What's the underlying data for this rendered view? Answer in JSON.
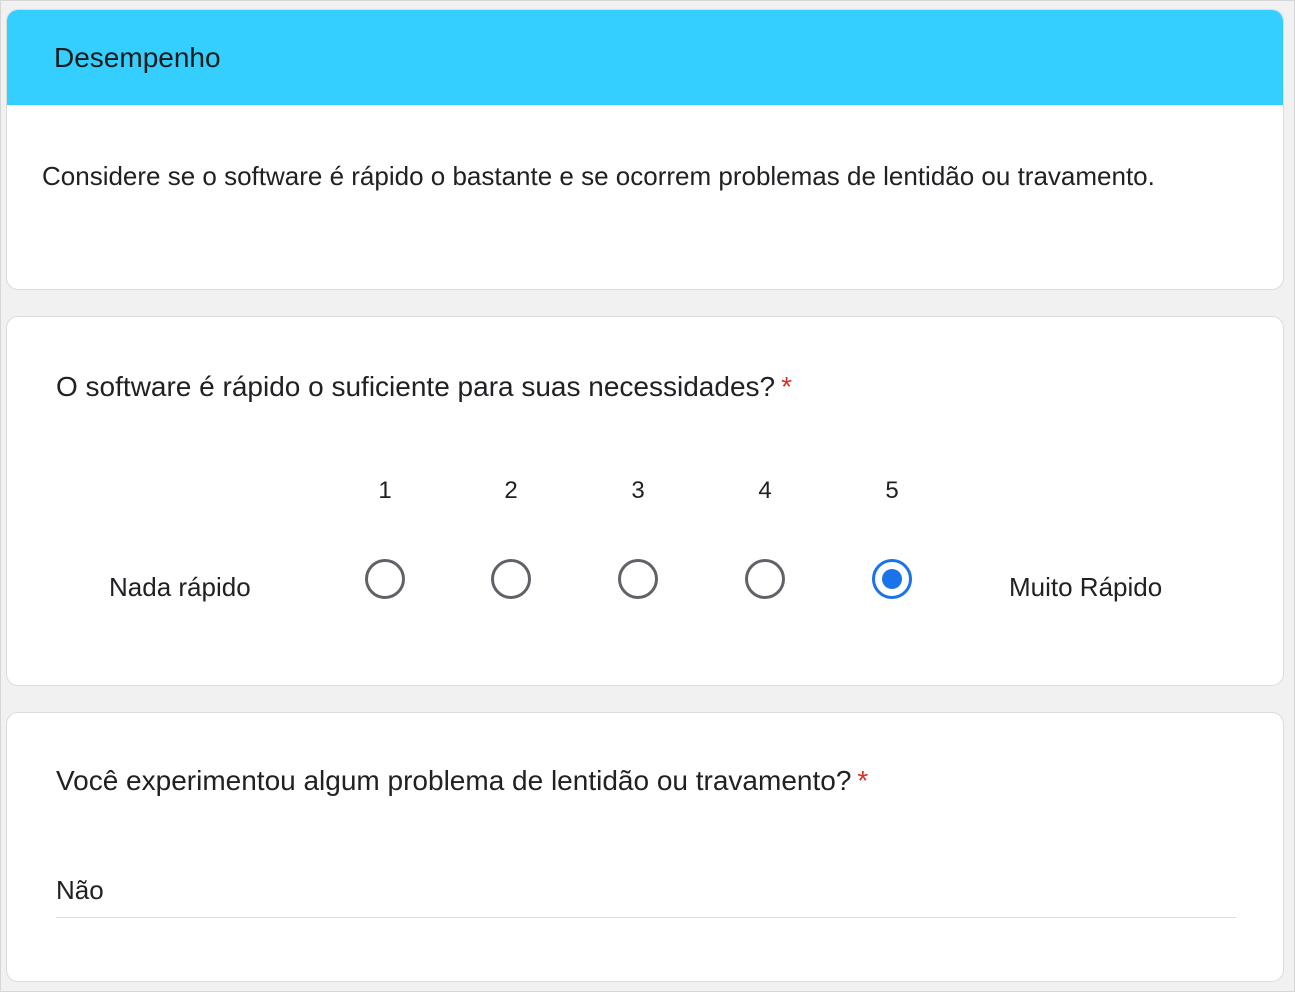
{
  "section": {
    "title": "Desempenho",
    "description": "Considere se o software é rápido o bastante e se ocorrem problemas de lentidão ou travamento.",
    "header_color": "#34cffe"
  },
  "question1": {
    "title": "O software é rápido o suficiente para suas necessidades?",
    "required_mark": "*",
    "scale": {
      "values": [
        "1",
        "2",
        "3",
        "4",
        "5"
      ],
      "selected": "5",
      "low_label": "Nada rápido",
      "high_label": "Muito Rápido"
    },
    "accent_color": "#1a73e8"
  },
  "question2": {
    "title": "Você experimentou algum problema de lentidão ou travamento?",
    "required_mark": "*",
    "answer": "Não"
  }
}
